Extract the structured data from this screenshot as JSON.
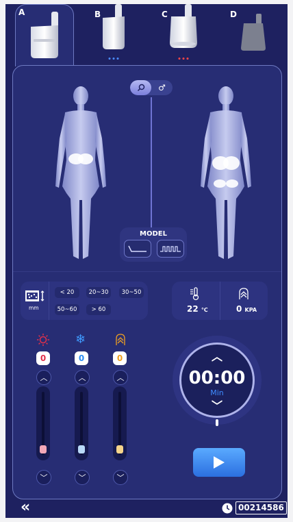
{
  "tabs": [
    {
      "letter": "A",
      "name": "handpiece-a"
    },
    {
      "letter": "B",
      "name": "handpiece-b"
    },
    {
      "letter": "C",
      "name": "handpiece-c"
    },
    {
      "letter": "D",
      "name": "handpiece-d"
    }
  ],
  "gender_toggle": {
    "left_icon": "⚲",
    "right_icon": "♂"
  },
  "model": {
    "title": "MODEL"
  },
  "thickness": {
    "unit": "mm",
    "options": [
      "< 20",
      "20~30",
      "30~50",
      "50~60",
      "> 60"
    ]
  },
  "readings": {
    "temperature": {
      "value": "22",
      "unit": "℃"
    },
    "pressure": {
      "value": "0",
      "unit": "KPA"
    }
  },
  "columns": [
    {
      "icon": "sun-icon",
      "value": "0",
      "color": "#e0304a"
    },
    {
      "icon": "snowflake-icon",
      "value": "0",
      "color": "#2a8bf2"
    },
    {
      "icon": "suction-icon",
      "value": "0",
      "color": "#f0a020"
    }
  ],
  "slider_levels": [
    0,
    0,
    0
  ],
  "timer": {
    "value": "00:00",
    "unit": "Min"
  },
  "footer": {
    "counter": "00214586",
    "back_icon": "«"
  },
  "colors": {
    "background": "#1e2160",
    "panel": "#272d74",
    "accent": "#5aaaff"
  }
}
